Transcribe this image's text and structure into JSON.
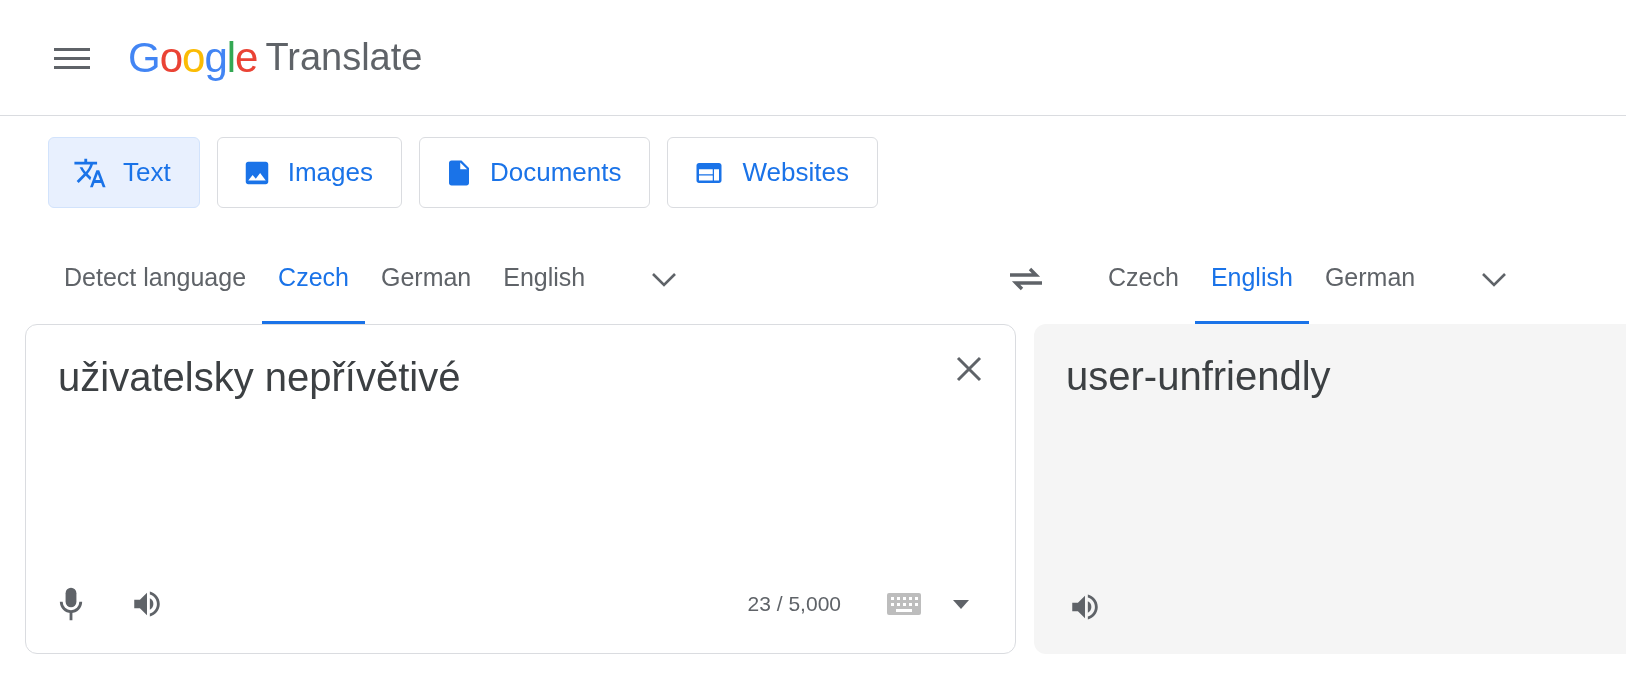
{
  "header": {
    "logo": "Google",
    "product": "Translate"
  },
  "modes": [
    {
      "label": "Text",
      "kind": "text",
      "selected": true
    },
    {
      "label": "Images",
      "kind": "images",
      "selected": false
    },
    {
      "label": "Documents",
      "kind": "documents",
      "selected": false
    },
    {
      "label": "Websites",
      "kind": "websites",
      "selected": false
    }
  ],
  "source_languages": [
    {
      "label": "Detect language",
      "selected": false
    },
    {
      "label": "Czech",
      "selected": true
    },
    {
      "label": "German",
      "selected": false
    },
    {
      "label": "English",
      "selected": false
    }
  ],
  "target_languages": [
    {
      "label": "Czech",
      "selected": false
    },
    {
      "label": "English",
      "selected": true
    },
    {
      "label": "German",
      "selected": false
    }
  ],
  "source": {
    "text": "uživatelsky nepřívětivé",
    "char_count": "23 / 5,000"
  },
  "target": {
    "text": "user-unfriendly"
  }
}
